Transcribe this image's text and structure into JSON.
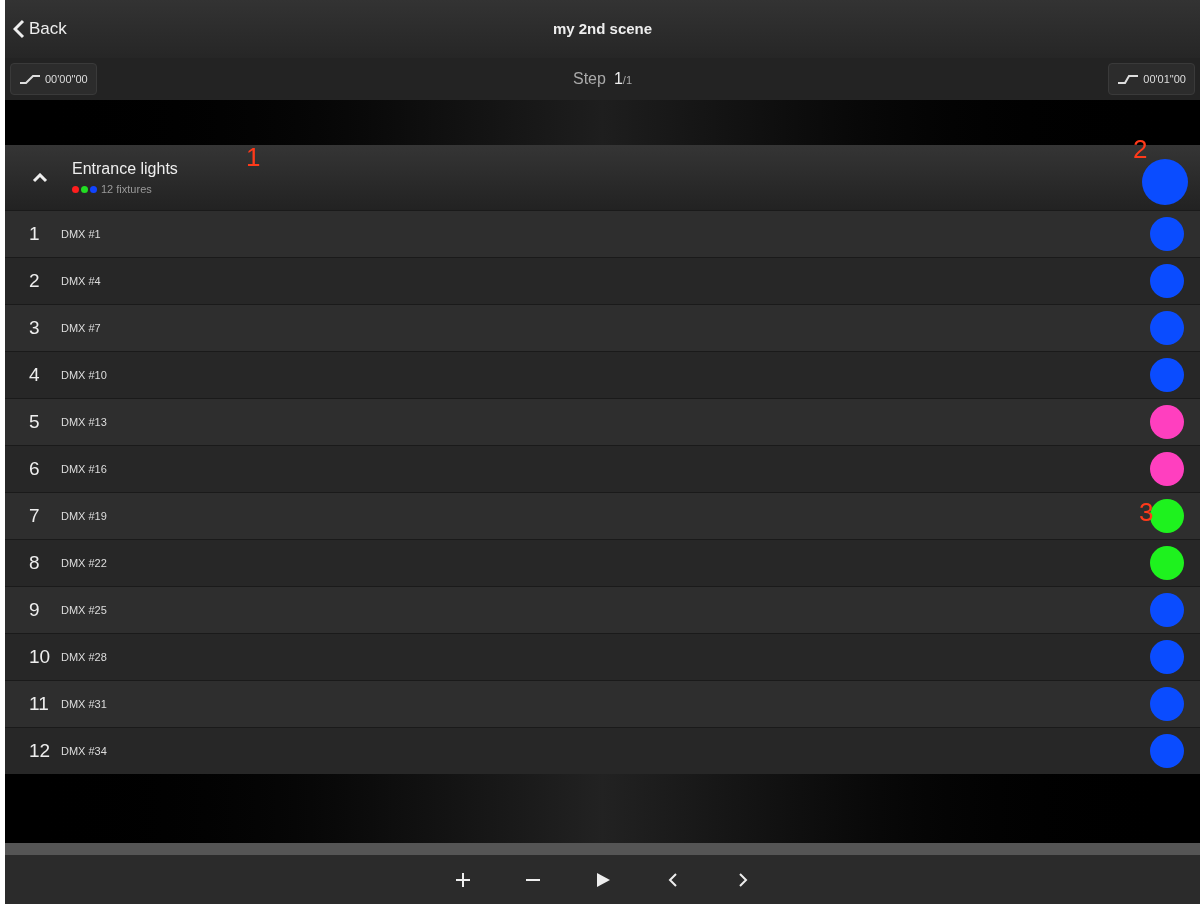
{
  "nav_bar": {
    "back": "Back",
    "title": "my 2nd scene"
  },
  "step_bar": {
    "fade_in": "00'00\"00",
    "step_label": "Step",
    "step_current": "1",
    "step_total": "/1",
    "fade_out": "00'01\"00"
  },
  "group": {
    "name": "Entrance lights",
    "count": "12 fixtures",
    "expanded": true,
    "color": "#0a4cff",
    "dots": [
      {
        "color": "#ff1e1e"
      },
      {
        "color": "#22dd22"
      },
      {
        "color": "#1144ff"
      }
    ]
  },
  "fixtures": [
    {
      "number": "1",
      "name": "DMX #1",
      "color": "#0a4cff"
    },
    {
      "number": "2",
      "name": "DMX #4",
      "color": "#0a4cff"
    },
    {
      "number": "3",
      "name": "DMX #7",
      "color": "#0a4cff"
    },
    {
      "number": "4",
      "name": "DMX #10",
      "color": "#0a4cff"
    },
    {
      "number": "5",
      "name": "DMX #13",
      "color": "#ff3fbf"
    },
    {
      "number": "6",
      "name": "DMX #16",
      "color": "#ff3fbf"
    },
    {
      "number": "7",
      "name": "DMX #19",
      "color": "#1ef21e"
    },
    {
      "number": "8",
      "name": "DMX #22",
      "color": "#1ef21e"
    },
    {
      "number": "9",
      "name": "DMX #25",
      "color": "#0a4cff"
    },
    {
      "number": "10",
      "name": "DMX #28",
      "color": "#0a4cff"
    },
    {
      "number": "11",
      "name": "DMX #31",
      "color": "#0a4cff"
    },
    {
      "number": "12",
      "name": "DMX #34",
      "color": "#0a4cff"
    }
  ],
  "callouts": [
    "1",
    "2",
    "3"
  ],
  "toolbar": [
    {
      "kind": "add"
    },
    {
      "kind": "remove"
    },
    {
      "kind": "play"
    },
    {
      "kind": "previous"
    },
    {
      "kind": "next"
    }
  ]
}
